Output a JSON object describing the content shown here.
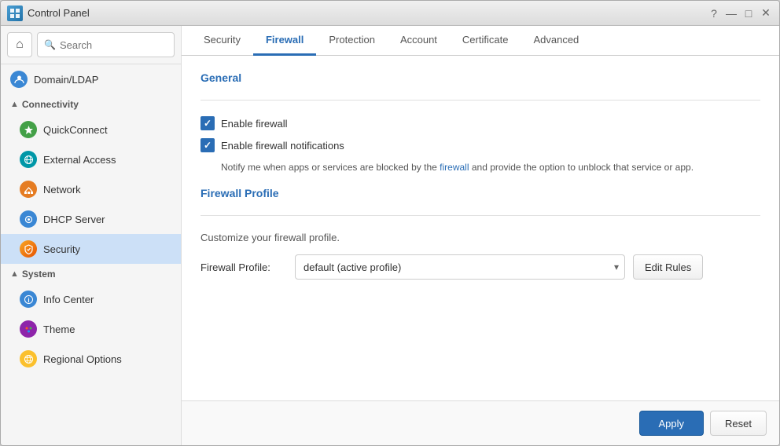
{
  "window": {
    "title": "Control Panel",
    "icon": "☰"
  },
  "titlebar": {
    "controls": {
      "help": "?",
      "minimize": "—",
      "maximize": "□",
      "close": "✕"
    }
  },
  "sidebar": {
    "search_placeholder": "Search",
    "home_icon": "⌂",
    "items": [
      {
        "id": "domain-ldap",
        "label": "Domain/LDAP",
        "icon": "👤",
        "icon_class": "icon-blue",
        "icon_char": "D"
      },
      {
        "id": "connectivity-header",
        "label": "Connectivity",
        "type": "section"
      },
      {
        "id": "quickconnect",
        "label": "QuickConnect",
        "icon_class": "icon-green",
        "icon_char": "⚡"
      },
      {
        "id": "external-access",
        "label": "External Access",
        "icon_class": "icon-cyan",
        "icon_char": "🌐"
      },
      {
        "id": "network",
        "label": "Network",
        "icon_class": "icon-orange",
        "icon_char": "🏠"
      },
      {
        "id": "dhcp-server",
        "label": "DHCP Server",
        "icon_class": "icon-blue",
        "icon_char": "⚙"
      },
      {
        "id": "security",
        "label": "Security",
        "icon_class": "icon-shield",
        "icon_char": "🛡",
        "active": true
      },
      {
        "id": "system-header",
        "label": "System",
        "type": "section"
      },
      {
        "id": "info-center",
        "label": "Info Center",
        "icon_class": "icon-blue",
        "icon_char": "ℹ"
      },
      {
        "id": "theme",
        "label": "Theme",
        "icon_class": "icon-purple",
        "icon_char": "🎨"
      },
      {
        "id": "regional-options",
        "label": "Regional Options",
        "icon_class": "icon-yellow",
        "icon_char": "🗺"
      }
    ]
  },
  "tabs": [
    {
      "id": "security",
      "label": "Security"
    },
    {
      "id": "firewall",
      "label": "Firewall",
      "active": true
    },
    {
      "id": "protection",
      "label": "Protection"
    },
    {
      "id": "account",
      "label": "Account"
    },
    {
      "id": "certificate",
      "label": "Certificate"
    },
    {
      "id": "advanced",
      "label": "Advanced"
    }
  ],
  "content": {
    "general_section": {
      "title": "General",
      "enable_firewall_label": "Enable firewall",
      "enable_firewall_checked": true,
      "enable_notifications_label": "Enable firewall notifications",
      "enable_notifications_checked": true,
      "info_text_part1": "Notify me when apps or services are blocked by the",
      "info_text_highlight": "firewall",
      "info_text_part2": "and provide the option to unblock that service or app."
    },
    "firewall_profile_section": {
      "title": "Firewall Profile",
      "description": "Customize your firewall profile.",
      "profile_label": "Firewall Profile:",
      "profile_value": "default (active profile)",
      "edit_rules_label": "Edit Rules"
    }
  },
  "footer": {
    "apply_label": "Apply",
    "reset_label": "Reset"
  }
}
